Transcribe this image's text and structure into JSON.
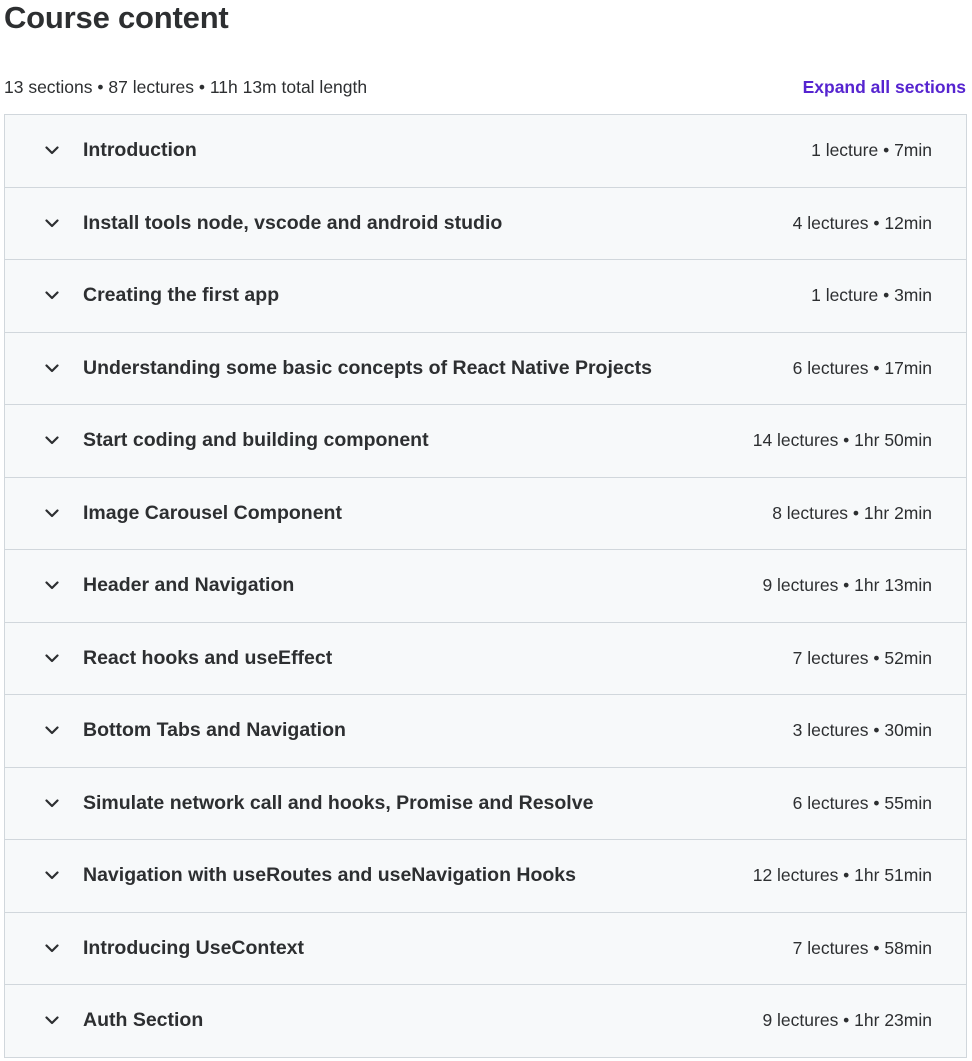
{
  "page": {
    "title": "Course content",
    "summary": "13 sections • 87 lectures • 11h 13m total length",
    "expand_label": "Expand all sections",
    "accent_color": "#5624d0"
  },
  "sections": [
    {
      "title": "Introduction",
      "meta": "1 lecture • 7min"
    },
    {
      "title": "Install tools node, vscode and android studio",
      "meta": "4 lectures • 12min"
    },
    {
      "title": "Creating the first app",
      "meta": "1 lecture • 3min"
    },
    {
      "title": "Understanding some basic concepts of React Native Projects",
      "meta": "6 lectures • 17min"
    },
    {
      "title": "Start coding and building component",
      "meta": "14 lectures • 1hr 50min"
    },
    {
      "title": "Image Carousel Component",
      "meta": "8 lectures • 1hr 2min"
    },
    {
      "title": "Header and Navigation",
      "meta": "9 lectures • 1hr 13min"
    },
    {
      "title": "React hooks and useEffect",
      "meta": "7 lectures • 52min"
    },
    {
      "title": "Bottom Tabs and Navigation",
      "meta": "3 lectures • 30min"
    },
    {
      "title": "Simulate network call and hooks, Promise and Resolve",
      "meta": "6 lectures • 55min"
    },
    {
      "title": "Navigation with useRoutes and useNavigation Hooks",
      "meta": "12 lectures • 1hr 51min"
    },
    {
      "title": "Introducing UseContext",
      "meta": "7 lectures • 58min"
    },
    {
      "title": "Auth Section",
      "meta": "9 lectures • 1hr 23min"
    }
  ],
  "icons": {
    "section_toggle": "chevron-down-icon"
  }
}
